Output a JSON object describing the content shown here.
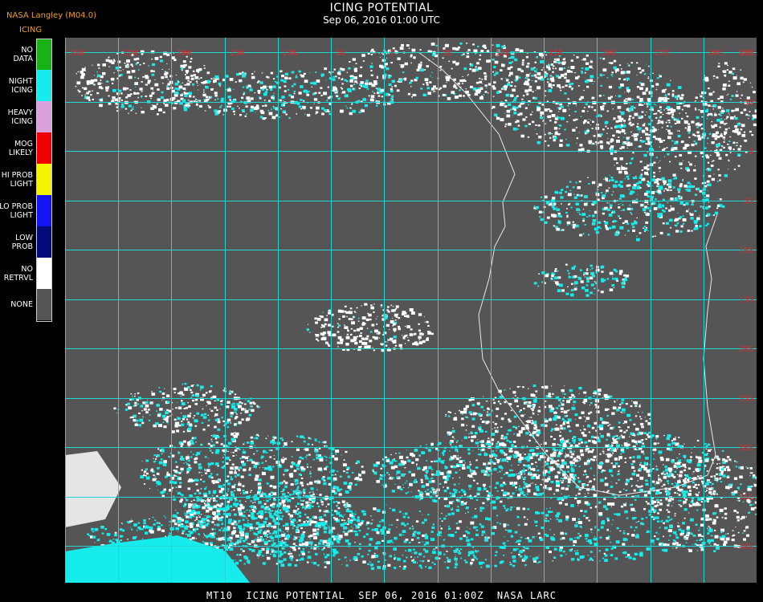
{
  "header": {
    "source": "NASA Langley (M04.0)",
    "product": "ICING",
    "title": "ICING POTENTIAL",
    "subtitle": "Sep 06, 2016 01:00 UTC"
  },
  "legend": [
    {
      "label": "NO DATA",
      "color": "#16b216"
    },
    {
      "label": "NIGHT ICING",
      "color": "#16ecec"
    },
    {
      "label": "HEAVY ICING",
      "color": "#dca0dc"
    },
    {
      "label": "MOG LIKELY",
      "color": "#ee0000"
    },
    {
      "label": "HI PROB LIGHT",
      "color": "#f4f400"
    },
    {
      "label": "LO PROB LIGHT",
      "color": "#1414f0"
    },
    {
      "label": "LOW PROB",
      "color": "#050a7a"
    },
    {
      "label": "NO RETRVL",
      "color": "#ffffff"
    },
    {
      "label": "NONE",
      "color": "#555555"
    }
  ],
  "map": {
    "background": "#555555",
    "grid_color": "#22d6d6",
    "label_color": "#d03030",
    "lon_labels": [
      "30W",
      "25W",
      "20W",
      "15W",
      "10W",
      "5W",
      "0",
      "5E",
      "10E",
      "15E",
      "20E",
      "25E",
      "30E",
      "35E"
    ],
    "lat_labels": [
      "10N",
      "5N",
      "0",
      "5S",
      "10S",
      "15S",
      "20S",
      "25S",
      "30S",
      "35S",
      "40S"
    ]
  },
  "footer": "MT10  ICING POTENTIAL  SEP 06, 2016 01:00Z  NASA LARC"
}
